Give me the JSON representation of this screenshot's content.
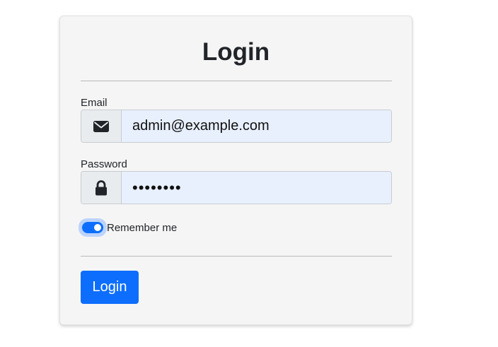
{
  "form": {
    "title": "Login",
    "email": {
      "label": "Email",
      "value": "admin@example.com",
      "icon": "envelope-icon"
    },
    "password": {
      "label": "Password",
      "value": "password",
      "icon": "lock-icon"
    },
    "remember": {
      "label": "Remember me",
      "checked": true
    },
    "submit_label": "Login"
  },
  "colors": {
    "primary": "#0d6efd",
    "card_bg": "#f5f5f5",
    "autofill_bg": "#e8f0fe",
    "addon_bg": "#e9ecef"
  }
}
